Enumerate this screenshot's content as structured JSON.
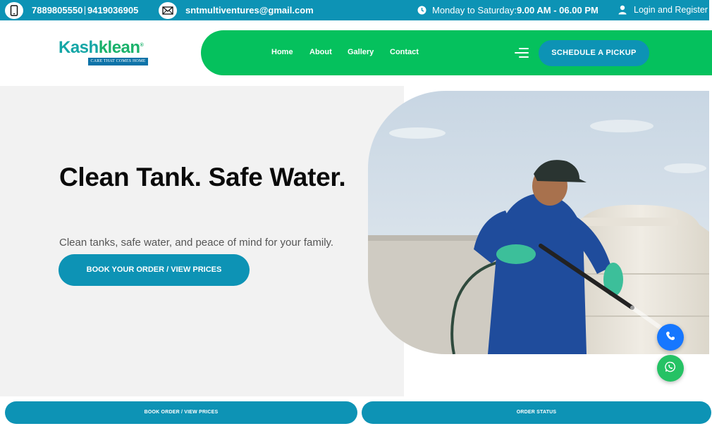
{
  "topbar": {
    "phone1": "7889805550",
    "phone2": "9419036905",
    "email": "sntmultiventures@gmail.com",
    "hours_prefix": "Monday to Saturday:",
    "hours_value": "9.00 AM - 06.00 PM",
    "login": "Login and Register",
    "icons": [
      "phone-icon",
      "mail-icon",
      "clock-icon",
      "user-icon"
    ]
  },
  "brand": {
    "name_part1": "Kash",
    "name_part2": "klean",
    "tagline": "CARE THAT COMES HOME"
  },
  "nav": {
    "items": [
      "Home",
      "About",
      "Gallery",
      "Contact"
    ],
    "cta": "SCHEDULE A PICKUP"
  },
  "hero": {
    "title": "Clean Tank. Safe Water.",
    "subtitle": "Clean tanks, safe water, and peace of mind for your family.",
    "button": "BOOK YOUR ORDER / VIEW PRICES"
  },
  "bottom_bar": {
    "left": "BOOK ORDER / VIEW PRICES",
    "right": "ORDER STATUS"
  },
  "colors": {
    "primary": "#0d93b5",
    "accent_green": "#05c15d",
    "call_fab": "#1677ff",
    "whatsapp_fab": "#25c264"
  }
}
